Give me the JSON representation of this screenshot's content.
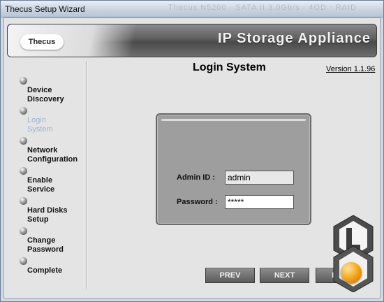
{
  "window": {
    "title": "Thecus Setup Wizard",
    "ghost_text": "Thecus N5200 · SATA II 3.0Gb/s · 4OD · RAID"
  },
  "banner": {
    "logo": "Thecus",
    "product": "IP Storage Appliance"
  },
  "sidebar": {
    "steps": [
      {
        "line1": "Device",
        "line2": "Discovery",
        "active": false
      },
      {
        "line1": "Login",
        "line2": "System",
        "active": true
      },
      {
        "line1": "Network",
        "line2": "Configuration",
        "active": false
      },
      {
        "line1": "Enable",
        "line2": "Service",
        "active": false
      },
      {
        "line1": "Hard Disks",
        "line2": "Setup",
        "active": false
      },
      {
        "line1": "Change",
        "line2": "Password",
        "active": false
      },
      {
        "line1": "Complete",
        "line2": "",
        "active": false
      }
    ]
  },
  "main": {
    "title": "Login System",
    "version": "Version 1.1.96"
  },
  "login": {
    "admin_label": "Admin ID :",
    "admin_value": "admin",
    "password_label": "Password :",
    "password_value": "*****"
  },
  "buttons": {
    "prev": "PREV",
    "next": "NEXT",
    "exit": "EXIT"
  },
  "colors": {
    "active_step": "#9cb3d6",
    "banner_dark": "#4a4a4a",
    "panel": "#9e9e9e",
    "orb": "#f7a51c"
  }
}
